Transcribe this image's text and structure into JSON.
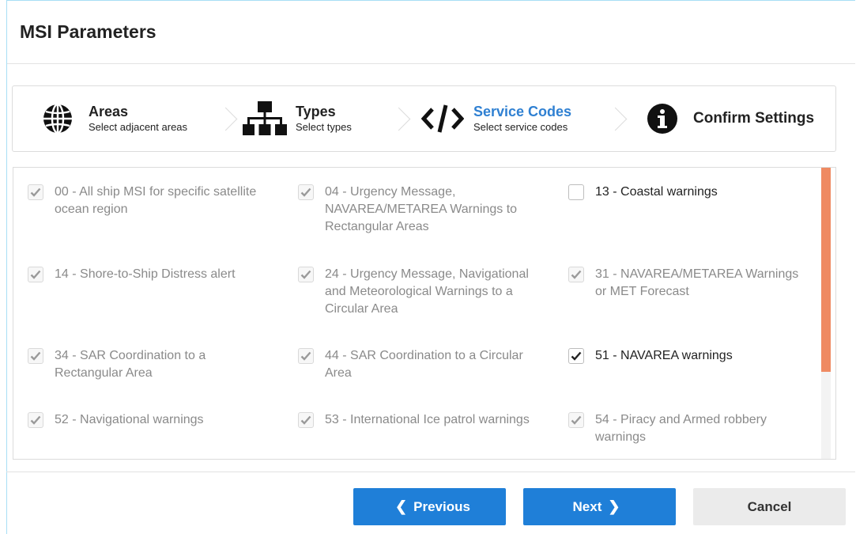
{
  "dialog": {
    "title": "MSI Parameters"
  },
  "steps": [
    {
      "title": "Areas",
      "description": "Select adjacent areas",
      "icon": "globe-icon",
      "state": "done"
    },
    {
      "title": "Types",
      "description": "Select types",
      "icon": "sitemap-icon",
      "state": "done"
    },
    {
      "title": "Service Codes",
      "description": "Select service codes",
      "icon": "code-icon",
      "state": "active"
    },
    {
      "title": "Confirm Settings",
      "description": "",
      "icon": "info-circle-icon",
      "state": "pending"
    }
  ],
  "codes": [
    {
      "label": "00 - All ship MSI for specific satellite ocean region",
      "checked": true,
      "disabled": true
    },
    {
      "label": "04 - Urgency Message, NAVAREA/METAREA Warnings to Rectangular Areas",
      "checked": true,
      "disabled": true
    },
    {
      "label": "13 - Coastal warnings",
      "checked": false,
      "disabled": false
    },
    {
      "label": "14 - Shore-to-Ship Distress alert",
      "checked": true,
      "disabled": true
    },
    {
      "label": "24 - Urgency Message, Navigational and Meteorological Warnings to a Circular Area",
      "checked": true,
      "disabled": true
    },
    {
      "label": "31 - NAVAREA/METAREA Warnings or MET Forecast",
      "checked": true,
      "disabled": true
    },
    {
      "label": "34 - SAR Coordination to a Rectangular Area",
      "checked": true,
      "disabled": true
    },
    {
      "label": "44 - SAR Coordination to a Circular Area",
      "checked": true,
      "disabled": true
    },
    {
      "label": "51 - NAVAREA warnings",
      "checked": true,
      "disabled": false
    },
    {
      "label": "52 - Navigational warnings",
      "checked": true,
      "disabled": true
    },
    {
      "label": "53 - International Ice patrol warnings",
      "checked": true,
      "disabled": true
    },
    {
      "label": "54 - Piracy and Armed robbery warnings",
      "checked": true,
      "disabled": true
    }
  ],
  "footer": {
    "previous_label": "Previous",
    "next_label": "Next",
    "cancel_label": "Cancel"
  },
  "colors": {
    "accent": "#1f7fd8",
    "active_step": "#2f80d2",
    "scroll_thumb": "#ef8a62",
    "check_enabled": "#222222",
    "check_disabled": "#9a9a9a"
  }
}
